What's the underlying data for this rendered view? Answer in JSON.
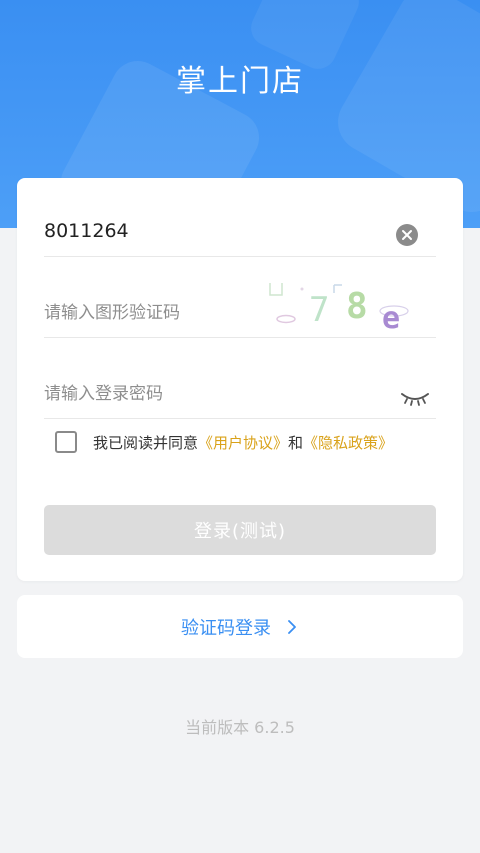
{
  "header": {
    "title": "掌上门店",
    "color": "#4a9cf6"
  },
  "login_form": {
    "account": {
      "value": "8011264"
    },
    "captcha": {
      "placeholder": "请输入图形验证码",
      "image_text": "78e"
    },
    "password": {
      "placeholder": "请输入登录密码"
    },
    "agreement": {
      "prefix": "我已阅读并同意",
      "user_agreement": "《用户协议》",
      "conjunction": "和",
      "privacy_policy": "《隐私政策》",
      "checked": false
    },
    "login_button_label": "登录(测试)"
  },
  "alt_login": {
    "label": "验证码登录"
  },
  "footer": {
    "version_label": "当前版本 6.2.5"
  },
  "colors": {
    "accent": "#3a8ff2",
    "link": "#d9a21a",
    "disabled_button": "#dcdcdc"
  }
}
